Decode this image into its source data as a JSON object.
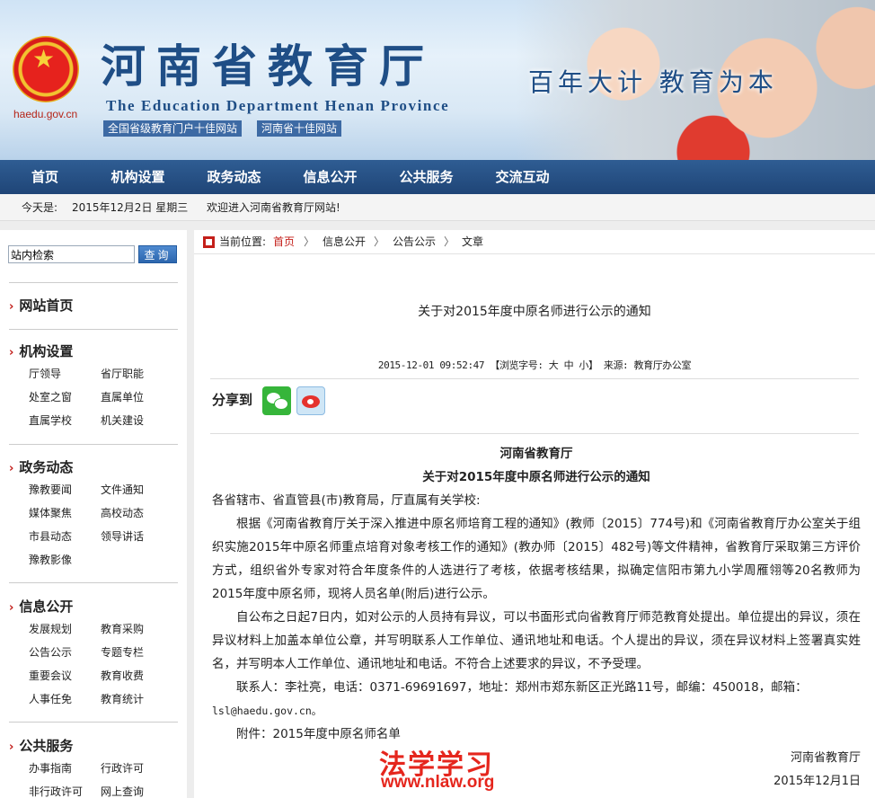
{
  "header": {
    "site_title": "河南省教育厅",
    "site_subtitle": "The Education Department Henan Province",
    "domain": "haedu.gov.cn",
    "awards": [
      "全国省级教育门户十佳网站",
      "河南省十佳网站"
    ],
    "slogan": "百年大计  教育为本"
  },
  "nav": {
    "items": [
      "首页",
      "机构设置",
      "政务动态",
      "信息公开",
      "公共服务",
      "交流互动"
    ]
  },
  "datebar": {
    "label": "今天是:",
    "date": "2015年12月2日 星期三",
    "welcome": "欢迎进入河南省教育厅网站!"
  },
  "sidebar": {
    "search_value": "站内检索",
    "search_button": "查询",
    "sections": [
      {
        "title": "网站首页",
        "links": []
      },
      {
        "title": "机构设置",
        "links": [
          "厅领导",
          "省厅职能",
          "处室之窗",
          "直属单位",
          "直属学校",
          "机关建设"
        ]
      },
      {
        "title": "政务动态",
        "links": [
          "豫教要闻",
          "文件通知",
          "媒体聚焦",
          "高校动态",
          "市县动态",
          "领导讲话",
          "豫教影像"
        ]
      },
      {
        "title": "信息公开",
        "links": [
          "发展规划",
          "教育采购",
          "公告公示",
          "专题专栏",
          "重要会议",
          "教育收费",
          "人事任免",
          "教育统计"
        ]
      },
      {
        "title": "公共服务",
        "links": [
          "办事指南",
          "行政许可",
          "非行政许可",
          "网上查询"
        ]
      }
    ]
  },
  "breadcrumb": {
    "label": "当前位置:",
    "items": [
      "首页",
      "信息公开",
      "公告公示",
      "文章"
    ],
    "sep": "〉"
  },
  "article": {
    "title": "关于对2015年度中原名师进行公示的通知",
    "meta": "2015-12-01 09:52:47 【浏览字号: 大 中 小】 来源: 教育厅办公室",
    "share_label": "分享到",
    "org": "河南省教育厅",
    "subtitle": "关于对2015年度中原名师进行公示的通知",
    "salutation": "各省辖市、省直管县(市)教育局，厅直属有关学校:",
    "para1": "根据《河南省教育厅关于深入推进中原名师培育工程的通知》(教师〔2015〕774号)和《河南省教育厅办公室关于组织实施2015年中原名师重点培育对象考核工作的通知》(教办师〔2015〕482号)等文件精神，省教育厅采取第三方评价方式，组织省外专家对符合年度条件的人选进行了考核，依据考核结果，拟确定信阳市第九小学周雁翎等20名教师为2015年度中原名师，现将人员名单(附后)进行公示。",
    "para2": "自公布之日起7日内，如对公示的人员持有异议，可以书面形式向省教育厅师范教育处提出。单位提出的异议，须在异议材料上加盖本单位公章，并写明联系人工作单位、通讯地址和电话。个人提出的异议，须在异议材料上签署真实姓名，并写明本人工作单位、通讯地址和电话。不符合上述要求的异议，不予受理。",
    "contact": "联系人：李社亮，电话：0371-69691697，地址：郑州市郑东新区正光路11号，邮编：450018，邮箱：",
    "email": "lsl@haedu.gov.cn。",
    "attachment": "附件：2015年度中原名师名单",
    "sign_org": "河南省教育厅",
    "sign_date": "2015年12月1日"
  },
  "watermark": {
    "cn": "法学学习",
    "url": "www.nlaw.org"
  }
}
